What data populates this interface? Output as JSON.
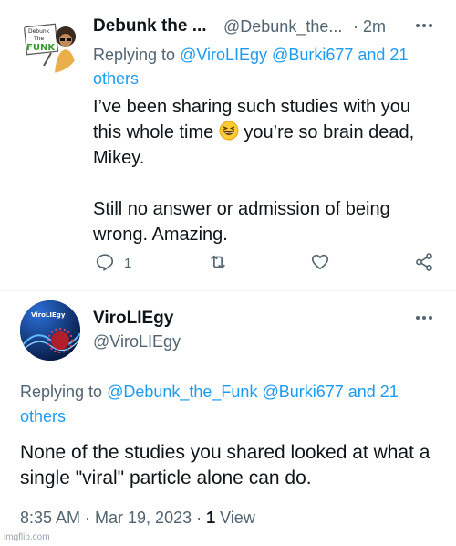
{
  "tweet1": {
    "name": "Debunk the ...",
    "handle": "@Debunk_the...",
    "time": "· 2m",
    "avatar_text": [
      "Debunk",
      "The",
      "FUNK"
    ],
    "replying_prefix": "Replying to ",
    "replying_mentions": "@ViroLIEgy @Burki677 and 21 others",
    "body_line1_a": "I’ve been sharing such studies with you this whole time ",
    "body_line1_b": " you’re so brain dead, Mikey.",
    "body_para2": "Still no answer or admission of being wrong. Amazing.",
    "reply_count": "1",
    "icons": [
      "reply-icon",
      "retweet-icon",
      "like-icon",
      "share-icon",
      "more-icon"
    ]
  },
  "tweet2": {
    "name": "ViroLIEgy",
    "handle": "@ViroLIEgy",
    "avatar_text": "ViroLIEgy",
    "replying_prefix": "Replying to ",
    "replying_mentions": "@Debunk_the_Funk @Burki677 and 21 others",
    "body": "None of the studies you shared looked at what a single \"viral\" particle alone can do.",
    "time": "8:35 AM · Mar 19, 2023 · ",
    "views_count": "1",
    "views_label": " View"
  },
  "watermark": "imgflip.com",
  "colors": {
    "accent": "#1d9bf0",
    "secondary": "#536471",
    "text": "#0f1419"
  }
}
